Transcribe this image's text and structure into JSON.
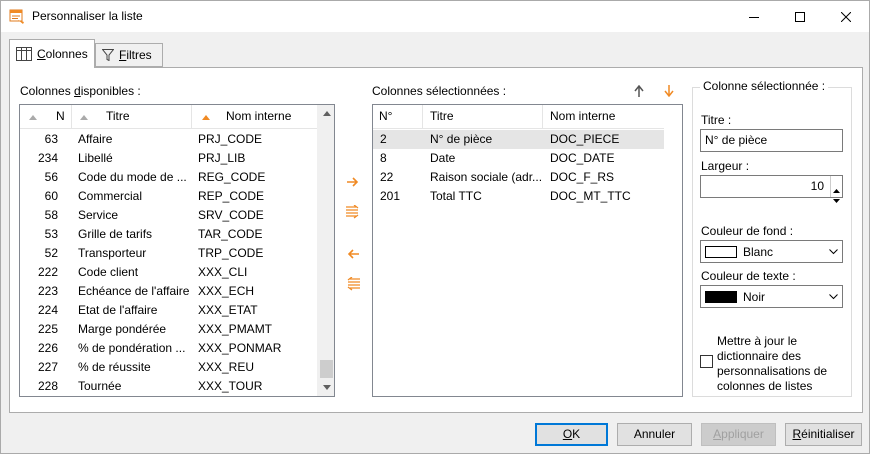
{
  "window": {
    "title": "Personnaliser la liste"
  },
  "tabs": [
    {
      "label_pre": "",
      "label_u": "C",
      "label_post": "olonnes",
      "icon": "columns-icon",
      "active": true
    },
    {
      "label_pre": "",
      "label_u": "F",
      "label_post": "iltres",
      "icon": "filter-icon",
      "active": false
    }
  ],
  "available": {
    "label_pre": "Colonnes ",
    "label_u": "d",
    "label_post": "isponibles :",
    "headers": {
      "num": "N",
      "title": "Titre",
      "internal": "Nom interne"
    },
    "rows": [
      {
        "num": "63",
        "title": "Affaire",
        "internal": "PRJ_CODE"
      },
      {
        "num": "234",
        "title": "Libellé",
        "internal": "PRJ_LIB"
      },
      {
        "num": "56",
        "title": "Code du mode de ...",
        "internal": "REG_CODE"
      },
      {
        "num": "60",
        "title": "Commercial",
        "internal": "REP_CODE"
      },
      {
        "num": "58",
        "title": "Service",
        "internal": "SRV_CODE"
      },
      {
        "num": "53",
        "title": "Grille de tarifs",
        "internal": "TAR_CODE"
      },
      {
        "num": "52",
        "title": "Transporteur",
        "internal": "TRP_CODE"
      },
      {
        "num": "222",
        "title": "Code client",
        "internal": "XXX_CLI"
      },
      {
        "num": "223",
        "title": "Echéance de l'affaire",
        "internal": "XXX_ECH"
      },
      {
        "num": "224",
        "title": "Etat de l'affaire",
        "internal": "XXX_ETAT"
      },
      {
        "num": "225",
        "title": "Marge pondérée",
        "internal": "XXX_PMAMT"
      },
      {
        "num": "226",
        "title": "% de pondération ...",
        "internal": "XXX_PONMAR"
      },
      {
        "num": "227",
        "title": "% de réussite",
        "internal": "XXX_REU"
      },
      {
        "num": "228",
        "title": "Tournée",
        "internal": "XXX_TOUR"
      }
    ],
    "scroll_position": 0.95
  },
  "selected": {
    "label": "Colonnes sélectionnées :",
    "headers": {
      "num": "N°",
      "title": "Titre",
      "internal": "Nom interne"
    },
    "rows": [
      {
        "num": "2",
        "title": "N° de pièce",
        "internal": "DOC_PIECE"
      },
      {
        "num": "8",
        "title": "Date",
        "internal": "DOC_DATE"
      },
      {
        "num": "22",
        "title": "Raison sociale (adr...",
        "internal": "DOC_F_RS"
      },
      {
        "num": "201",
        "title": "Total TTC",
        "internal": "DOC_MT_TTC"
      }
    ],
    "selected_index": 0
  },
  "column_props": {
    "group_label": "Colonne sélectionnée :",
    "titre_label": "Titre :",
    "titre_value": "N° de pièce",
    "largeur_label": "Largeur :",
    "largeur_value": "10",
    "fond_label": "Couleur de fond :",
    "fond_value": "Blanc",
    "fond_color": "#ffffff",
    "texte_label": "Couleur de texte :",
    "texte_value": "Noir",
    "texte_color": "#000000",
    "checkbox_lines": [
      "Mettre à jour le",
      "dictionnaire des",
      "personnalisations de",
      "colonnes de listes"
    ],
    "checkbox_checked": false
  },
  "buttons": {
    "ok": {
      "u": "O",
      "post": "K"
    },
    "cancel": "Annuler",
    "apply": {
      "u": "A",
      "post": "ppliquer"
    },
    "reset": {
      "u": "R",
      "post": "éinitialiser"
    }
  },
  "colors": {
    "accent": "#f08a24",
    "selection": "#e5e5e5",
    "default_button_border": "#0078d7"
  }
}
